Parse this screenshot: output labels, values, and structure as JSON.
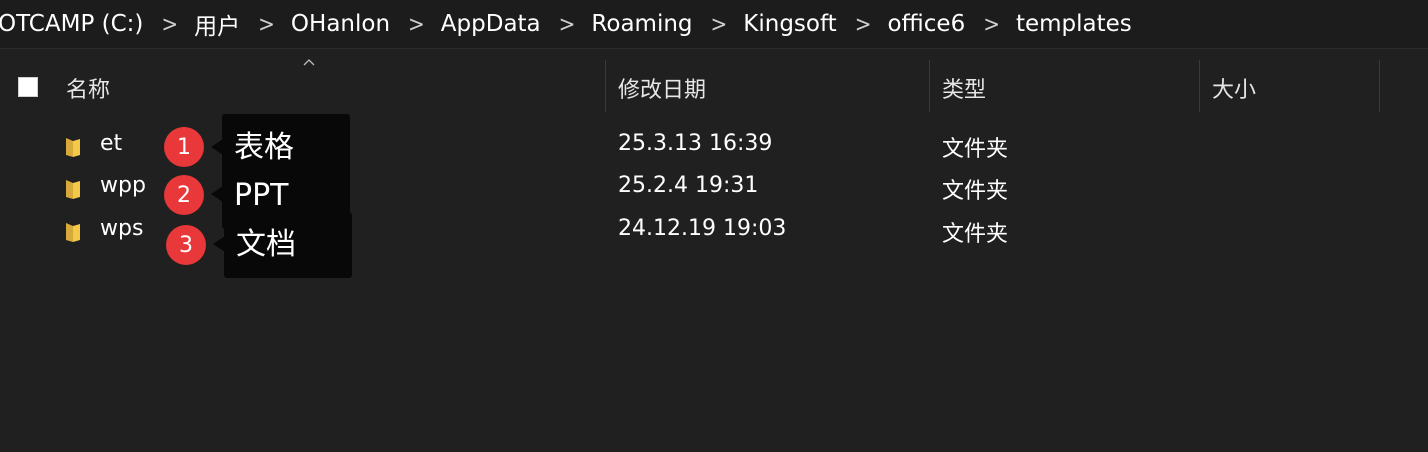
{
  "breadcrumb": {
    "items": [
      "OTCAMP (C:)",
      "用户",
      "OHanlon",
      "AppData",
      "Roaming",
      "Kingsoft",
      "office6",
      "templates"
    ],
    "separator": ">"
  },
  "columns": {
    "name": "名称",
    "modified": "修改日期",
    "type": "类型",
    "size": "大小"
  },
  "files": [
    {
      "name": "et",
      "modified": "25.3.13 16:39",
      "type": "文件夹",
      "size": ""
    },
    {
      "name": "wpp",
      "modified": "25.2.4 19:31",
      "type": "文件夹",
      "size": ""
    },
    {
      "name": "wps",
      "modified": "24.12.19 19:03",
      "type": "文件夹",
      "size": ""
    }
  ],
  "annotations": [
    {
      "number": "1",
      "label": "表格"
    },
    {
      "number": "2",
      "label": "PPT"
    },
    {
      "number": "3",
      "label": "文档"
    }
  ],
  "icons": {
    "folder": "folder-icon",
    "sort": "sort-ascending-icon",
    "chevron": "chevron-right-icon"
  },
  "colors": {
    "background": "#202020",
    "folder": "#f4c94a",
    "badge": "#e8383a",
    "tooltip": "#080808"
  }
}
